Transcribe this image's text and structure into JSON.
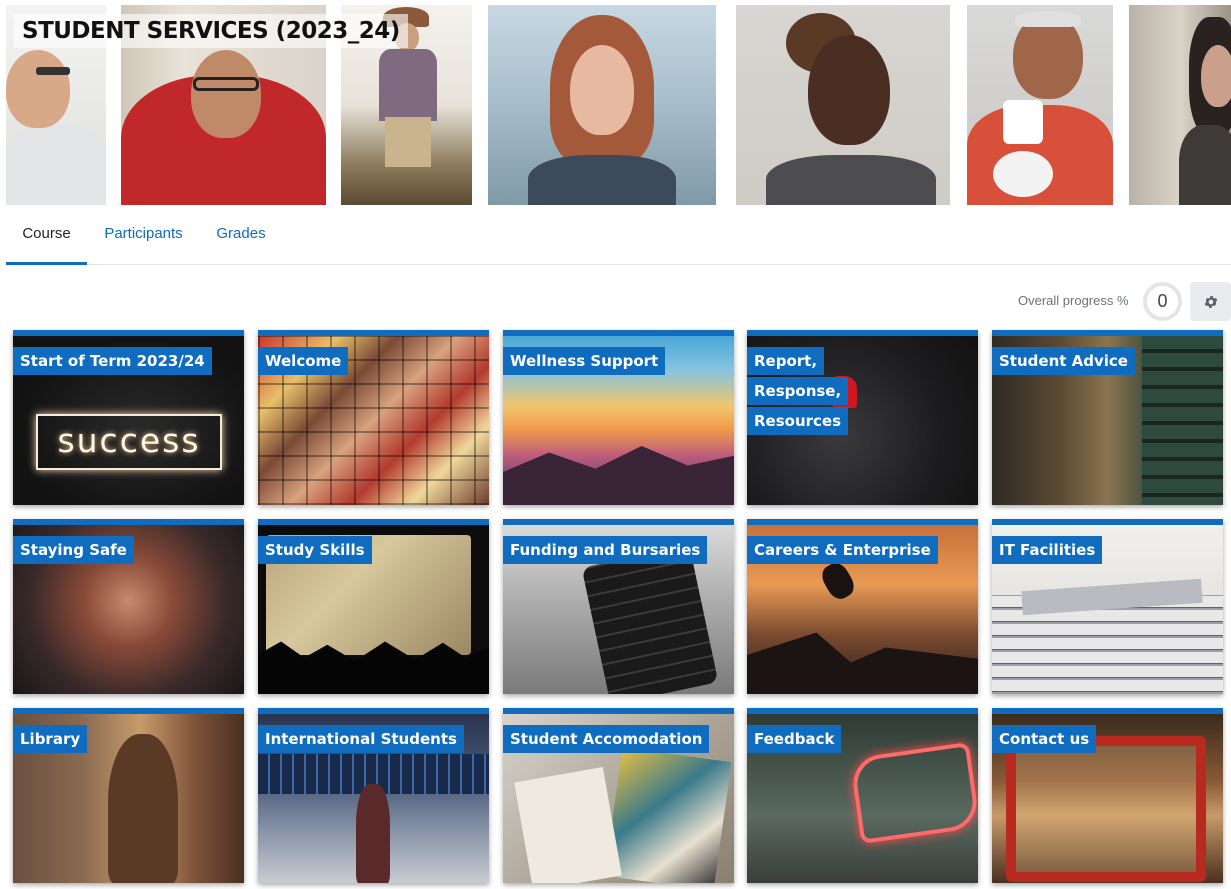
{
  "course": {
    "title": "STUDENT SERVICES (2023_24)"
  },
  "tabs": [
    {
      "label": "Course",
      "active": true
    },
    {
      "label": "Participants",
      "active": false
    },
    {
      "label": "Grades",
      "active": false
    }
  ],
  "progress": {
    "label": "Overall progress %",
    "value": "0",
    "settings_icon": "gear-icon"
  },
  "tiles": [
    {
      "title": "Start of Term 2023/24"
    },
    {
      "title": "Welcome"
    },
    {
      "title": "Wellness Support"
    },
    {
      "title": "Report, Response, Resources"
    },
    {
      "title": "Student Advice"
    },
    {
      "title": "Staying Safe"
    },
    {
      "title": "Study Skills"
    },
    {
      "title": "Funding and Bursaries"
    },
    {
      "title": "Careers & Enterprise"
    },
    {
      "title": "IT Facilities"
    },
    {
      "title": "Library"
    },
    {
      "title": "International Students"
    },
    {
      "title": "Student Accomodation"
    },
    {
      "title": "Feedback"
    },
    {
      "title": "Contact us"
    }
  ],
  "tile_images": {
    "start_of_term": {
      "text": "success"
    }
  },
  "colors": {
    "accent": "#0f6cbf",
    "tab_border": "#dee2e6",
    "muted_text": "#6a737b"
  }
}
